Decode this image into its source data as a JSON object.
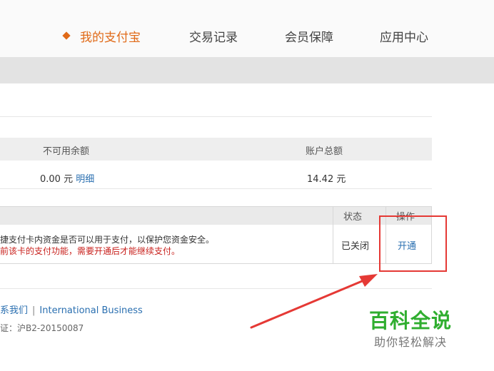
{
  "nav": {
    "items": [
      {
        "label": "我的支付宝",
        "active": true
      },
      {
        "label": "交易记录",
        "active": false
      },
      {
        "label": "会员保障",
        "active": false
      },
      {
        "label": "应用中心",
        "active": false
      }
    ]
  },
  "balance_table": {
    "headers": [
      "不可用余额",
      "账户总额"
    ],
    "unavailable_value": "0.00 元",
    "detail_link": "明细",
    "total_value": "14.42 元"
  },
  "card_table": {
    "headers": [
      "状态",
      "操作"
    ],
    "desc_line1": "捷支付卡内资金是否可以用于支付，以保护您资金安全。",
    "desc_line2": "前该卡的支付功能，需要开通后才能继续支付。",
    "status": "已关闭",
    "action": "开通"
  },
  "footer": {
    "contact": "系我们",
    "separator": "|",
    "international": "International Business",
    "license": "证：沪B2-20150087"
  },
  "watermark": {
    "title": "百科全说",
    "subtitle": "助你轻松解决"
  },
  "colors": {
    "accent": "#e06a18",
    "link": "#2a6fb0",
    "warning": "#c8201c",
    "annotation": "#e53935",
    "watermark": "#2fae2f"
  }
}
